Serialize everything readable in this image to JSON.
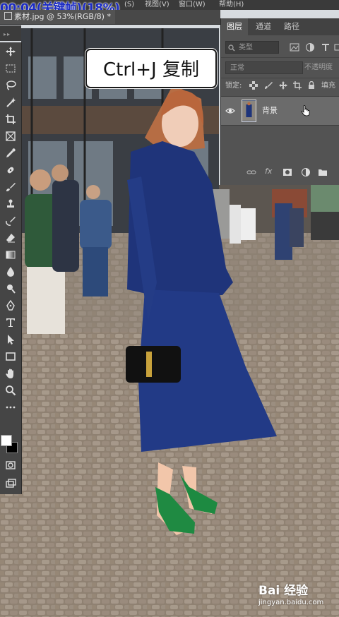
{
  "menubar": {
    "timestamp": "00:04(关键帧)(18%)",
    "partial_items": [
      "(S)",
      "视图(V)",
      "窗口(W)",
      "帮助(H)"
    ]
  },
  "document_tab": {
    "label": "素材.jpg @ 53%(RGB/8) *"
  },
  "toolbar": {
    "tools": [
      "move-icon",
      "marquee-icon",
      "lasso-icon",
      "magic-wand-icon",
      "crop-icon",
      "frame-icon",
      "eyedropper-icon",
      "healing-brush-icon",
      "brush-icon",
      "clone-stamp-icon",
      "history-brush-icon",
      "eraser-icon",
      "gradient-icon",
      "blur-icon",
      "dodge-icon",
      "pen-icon",
      "type-icon",
      "path-selection-icon",
      "rectangle-icon",
      "hand-icon",
      "zoom-icon",
      "more-tools-icon"
    ],
    "foreground_color": "#ffffff",
    "background_color": "#000000"
  },
  "caption": {
    "text": "Ctrl+J  复制"
  },
  "layers_panel": {
    "tabs": [
      "图层",
      "通道",
      "路径"
    ],
    "active_tab": "图层",
    "filter_placeholder": "类型",
    "blend_mode": "正常",
    "opacity_label": "不透明度",
    "lock_label": "锁定:",
    "fill_label": "填充",
    "layers": [
      {
        "name": "背景",
        "visible": true
      }
    ]
  },
  "watermark": {
    "brand": "Bai 经验",
    "url": "jingyan.baidu.com"
  },
  "colors": {
    "accent_blue": "#1b2bc4",
    "panel_bg": "#535353",
    "toolbar_bg": "#454545"
  }
}
